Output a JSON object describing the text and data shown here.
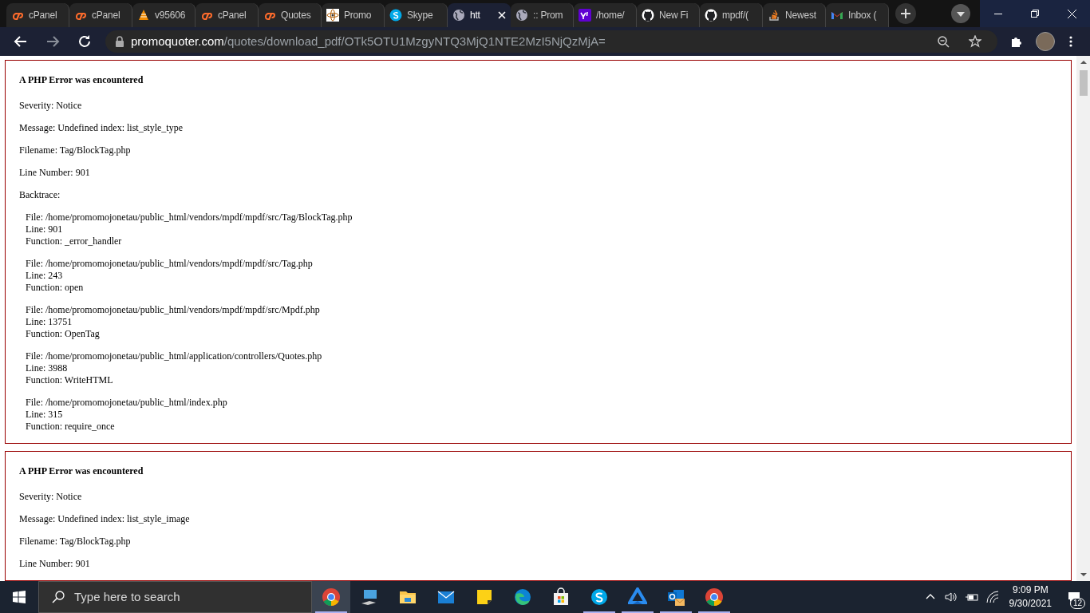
{
  "tabs": [
    {
      "label": "cPanel",
      "kind": "cpanel",
      "selected": false
    },
    {
      "label": "cPanel",
      "kind": "cpanel",
      "selected": false
    },
    {
      "label": "v95606",
      "kind": "cone",
      "selected": false
    },
    {
      "label": "cPanel",
      "kind": "cpanel",
      "selected": false
    },
    {
      "label": "Quotes",
      "kind": "cpanel",
      "selected": false
    },
    {
      "label": "Promo",
      "kind": "atom",
      "selected": false
    },
    {
      "label": "Skype",
      "kind": "skype",
      "selected": false
    },
    {
      "label": "htt",
      "kind": "globe",
      "selected": true
    },
    {
      "label": ":: Prom",
      "kind": "globe",
      "selected": false
    },
    {
      "label": "/home/",
      "kind": "yahoo",
      "selected": false
    },
    {
      "label": "New Fi",
      "kind": "github",
      "selected": false
    },
    {
      "label": "mpdf/(",
      "kind": "github",
      "selected": false
    },
    {
      "label": "Newest",
      "kind": "stack",
      "selected": false
    },
    {
      "label": "Inbox (",
      "kind": "gmail",
      "selected": false
    }
  ],
  "address_bar": {
    "domain": "promoquoter.com",
    "path": "/quotes/download_pdf/OTk5OTU1MzgyNTQ3MjQ1NTE2MzI5NjQzMjA="
  },
  "errors": [
    {
      "heading": "A PHP Error was encountered",
      "lines": [
        "Severity: Notice",
        "Message: Undefined index: list_style_type",
        "Filename: Tag/BlockTag.php",
        "Line Number: 901",
        "Backtrace:"
      ],
      "backtrace": [
        {
          "file": "File: /home/promomojonetau/public_html/vendors/mpdf/mpdf/src/Tag/BlockTag.php",
          "line": "Line: 901",
          "function": "Function: _error_handler"
        },
        {
          "file": "File: /home/promomojonetau/public_html/vendors/mpdf/mpdf/src/Tag.php",
          "line": "Line: 243",
          "function": "Function: open"
        },
        {
          "file": "File: /home/promomojonetau/public_html/vendors/mpdf/mpdf/src/Mpdf.php",
          "line": "Line: 13751",
          "function": "Function: OpenTag"
        },
        {
          "file": "File: /home/promomojonetau/public_html/application/controllers/Quotes.php",
          "line": "Line: 3988",
          "function": "Function: WriteHTML"
        },
        {
          "file": "File: /home/promomojonetau/public_html/index.php",
          "line": "Line: 315",
          "function": "Function: require_once"
        }
      ]
    },
    {
      "heading": "A PHP Error was encountered",
      "lines": [
        "Severity: Notice",
        "Message: Undefined index: list_style_image",
        "Filename: Tag/BlockTag.php",
        "Line Number: 901"
      ]
    }
  ],
  "taskbar": {
    "search_placeholder": "Type here to search",
    "apps": [
      {
        "kind": "chrome",
        "running": true,
        "selected": true
      },
      {
        "kind": "computer",
        "running": false,
        "selected": false
      },
      {
        "kind": "folder",
        "running": false,
        "selected": false
      },
      {
        "kind": "mail",
        "running": false,
        "selected": false
      },
      {
        "kind": "sticky",
        "running": false,
        "selected": false
      },
      {
        "kind": "edge",
        "running": false,
        "selected": false
      },
      {
        "kind": "store",
        "running": false,
        "selected": false
      },
      {
        "kind": "skype",
        "running": true,
        "selected": false
      },
      {
        "kind": "triangle",
        "running": true,
        "selected": false
      },
      {
        "kind": "outlook",
        "running": true,
        "selected": false
      },
      {
        "kind": "chrome",
        "running": true,
        "selected": false
      }
    ],
    "time": "9:09 PM",
    "date": "9/30/2021",
    "notifications": "12"
  }
}
